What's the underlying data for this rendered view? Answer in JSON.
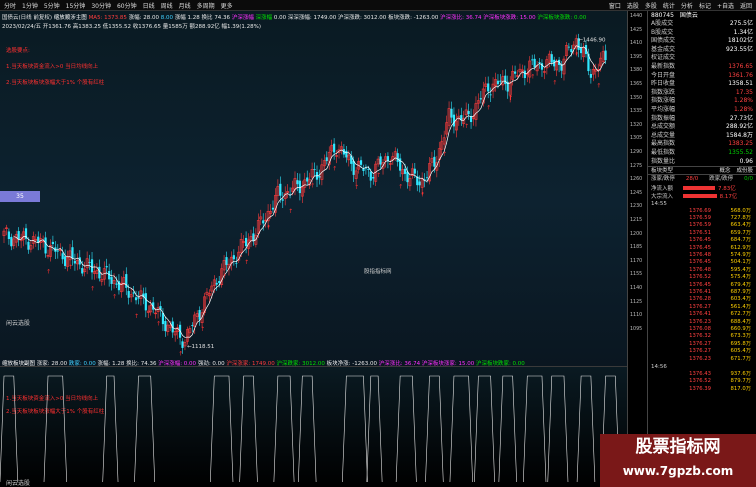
{
  "toolbar": {
    "items": [
      "分时",
      "1分钟",
      "5分钟",
      "15分钟",
      "30分钟",
      "60分钟",
      "日线",
      "周线",
      "月线",
      "多周期",
      "更多"
    ],
    "right": [
      "窗口",
      "选股",
      "多股",
      "统计",
      "分析",
      "标记",
      "+自选",
      "返回"
    ]
  },
  "info": {
    "title": "国债云(日线 前复权)",
    "indicator": "缩放顺涉主图",
    "ma": "MA5: 1373.85",
    "raise": "涨幅: 28.00",
    "spot": "8.00",
    "rise_label": "涨幅",
    "rise": "1.28",
    "ratio_label": "换比",
    "ratio": "74.36",
    "t1": "沪深涨幅",
    "t2": "深涨幅",
    "v1": "0.00",
    "t3": "深深涨幅: 1749.00",
    "t4": "沪深涨跌: 3012.00",
    "t5": "板块涨跌: -1263.00",
    "t6": "沪深涨比: 36.74",
    "t7": "沪深板块涨跌: 15.00",
    "t8": "沪深板块涨跌: 0.00",
    "line2": "2023/02/24/五  开1361.76  高1383.25  低1355.52  收1376.65  量1585万  额288.92亿  幅1.39(1.28%)"
  },
  "notes": {
    "main_1": "选股要点:",
    "main_2": "1.当天板块资金流入>0 当日均线向上",
    "main_3": "2.当天板块板块涨幅大于1% 个股有红柱",
    "sub_1": "1.当天板块资金流入>0 当日均线向上",
    "sub_2": "2.当天板块板块涨幅大于1% 个股有红柱",
    "main_bottom": "闲云选股",
    "sub_bottom": "闲云选股",
    "center": "股指指标网"
  },
  "sub_info": {
    "name": "缩放板块副图",
    "a": "涨家: 28.00",
    "b": "跌家: 0.00",
    "c": "涨幅: 1.28",
    "d": "换比: 74.36",
    "e": "沪深涨幅: 0.00",
    "f": "强劲: 0.00",
    "g": "沪深涨家: 1749.00",
    "h": "沪深跌家: 3012.00",
    "i": "板块净涨: -1263.00",
    "j": "沪深涨比: 36.74",
    "k": "沪深板块涨家: 15.00",
    "l": "沪深板块跌家: 0.00"
  },
  "price_labels": {
    "high": "1446.90",
    "low": "1118.51"
  },
  "tag35": "35",
  "y_axis": [
    "1440",
    "1425",
    "1410",
    "1395",
    "1380",
    "1365",
    "1350",
    "1335",
    "1320",
    "1305",
    "1290",
    "1275",
    "1260",
    "1245",
    "1230",
    "1215",
    "1200",
    "1185",
    "1170",
    "1155",
    "1140",
    "1125",
    "1110",
    "1095"
  ],
  "right_panel": {
    "code": "880745",
    "name": "国债云",
    "rows": [
      {
        "l": "A股成交",
        "v": "275.5亿",
        "c": ""
      },
      {
        "l": "B股成交",
        "v": "1.34亿",
        "c": ""
      },
      {
        "l": "国债成交",
        "v": "18102亿",
        "c": ""
      },
      {
        "l": "基金成交",
        "v": "923.55亿",
        "c": ""
      },
      {
        "l": "权证成交",
        "v": "",
        "c": ""
      },
      {
        "l": "最新指数",
        "v": "1376.65",
        "c": "red"
      },
      {
        "l": "今日开盘",
        "v": "1361.76",
        "c": "red"
      },
      {
        "l": "昨日收盘",
        "v": "1358.51",
        "c": ""
      },
      {
        "l": "指数涨跌",
        "v": "17.35",
        "c": "red"
      },
      {
        "l": "指数涨幅",
        "v": "1.28%",
        "c": "red"
      },
      {
        "l": "平均涨幅",
        "v": "1.28%",
        "c": "red"
      },
      {
        "l": "指数振幅",
        "v": "27.73亿",
        "c": ""
      },
      {
        "l": "总成交额",
        "v": "288.92亿",
        "c": ""
      },
      {
        "l": "总成交量",
        "v": "1584.8万",
        "c": ""
      },
      {
        "l": "最高指数",
        "v": "1383.25",
        "c": "red"
      },
      {
        "l": "最低指数",
        "v": "1355.52",
        "c": "grn"
      },
      {
        "l": "指数量比",
        "v": "0.96",
        "c": ""
      }
    ],
    "tabs": [
      "板块类型",
      "概念",
      "成份股"
    ],
    "breadth": {
      "l": "涨家/跌停",
      "v1": "28/0",
      "l2": "跌家/跌停",
      "v2": "0/0"
    },
    "flows": [
      {
        "l": "净流入额",
        "v": "7.83亿",
        "w": 0.8
      },
      {
        "l": "大宗流入",
        "v": "8.17亿",
        "w": 0.84
      }
    ],
    "ticks_time_1": "14:55",
    "ticks": [
      {
        "t": "",
        "p": "1376.69",
        "q": "568.0万"
      },
      {
        "t": "",
        "p": "1376.59",
        "q": "727.8万"
      },
      {
        "t": "",
        "p": "1376.59",
        "q": "663.4万"
      },
      {
        "t": "",
        "p": "1376.51",
        "q": "659.7万"
      },
      {
        "t": "",
        "p": "1376.45",
        "q": "684.7万"
      },
      {
        "t": "",
        "p": "1376.45",
        "q": "612.9万"
      },
      {
        "t": "",
        "p": "1376.48",
        "q": "574.9万"
      },
      {
        "t": "",
        "p": "1376.45",
        "q": "504.1万"
      },
      {
        "t": "",
        "p": "1376.48",
        "q": "595.4万"
      },
      {
        "t": "",
        "p": "1376.52",
        "q": "575.4万"
      },
      {
        "t": "",
        "p": "1376.45",
        "q": "679.4万"
      },
      {
        "t": "",
        "p": "1376.41",
        "q": "687.9万"
      },
      {
        "t": "",
        "p": "1376.28",
        "q": "603.4万"
      },
      {
        "t": "",
        "p": "1376.27",
        "q": "561.4万"
      },
      {
        "t": "",
        "p": "1376.41",
        "q": "672.7万"
      },
      {
        "t": "",
        "p": "1376.23",
        "q": "688.4万"
      },
      {
        "t": "",
        "p": "1376.08",
        "q": "660.9万"
      },
      {
        "t": "",
        "p": "1376.32",
        "q": "673.3万"
      },
      {
        "t": "",
        "p": "1376.27",
        "q": "695.8万"
      },
      {
        "t": "",
        "p": "1376.27",
        "q": "605.4万"
      },
      {
        "t": "",
        "p": "1376.23",
        "q": "671.7万"
      }
    ],
    "ticks_time_2": "14:56",
    "ticks2": [
      {
        "p": "1376.43",
        "q": "937.6万"
      },
      {
        "p": "1376.52",
        "q": "879.7万"
      },
      {
        "p": "1376.39",
        "q": "817.0万"
      }
    ]
  },
  "watermark": {
    "line1": "股票指标网",
    "line2": "www.7gpzb.com"
  },
  "colors": {
    "up": "#ff3c3c",
    "down": "#30e8ff",
    "ma": "#ffffff"
  }
}
